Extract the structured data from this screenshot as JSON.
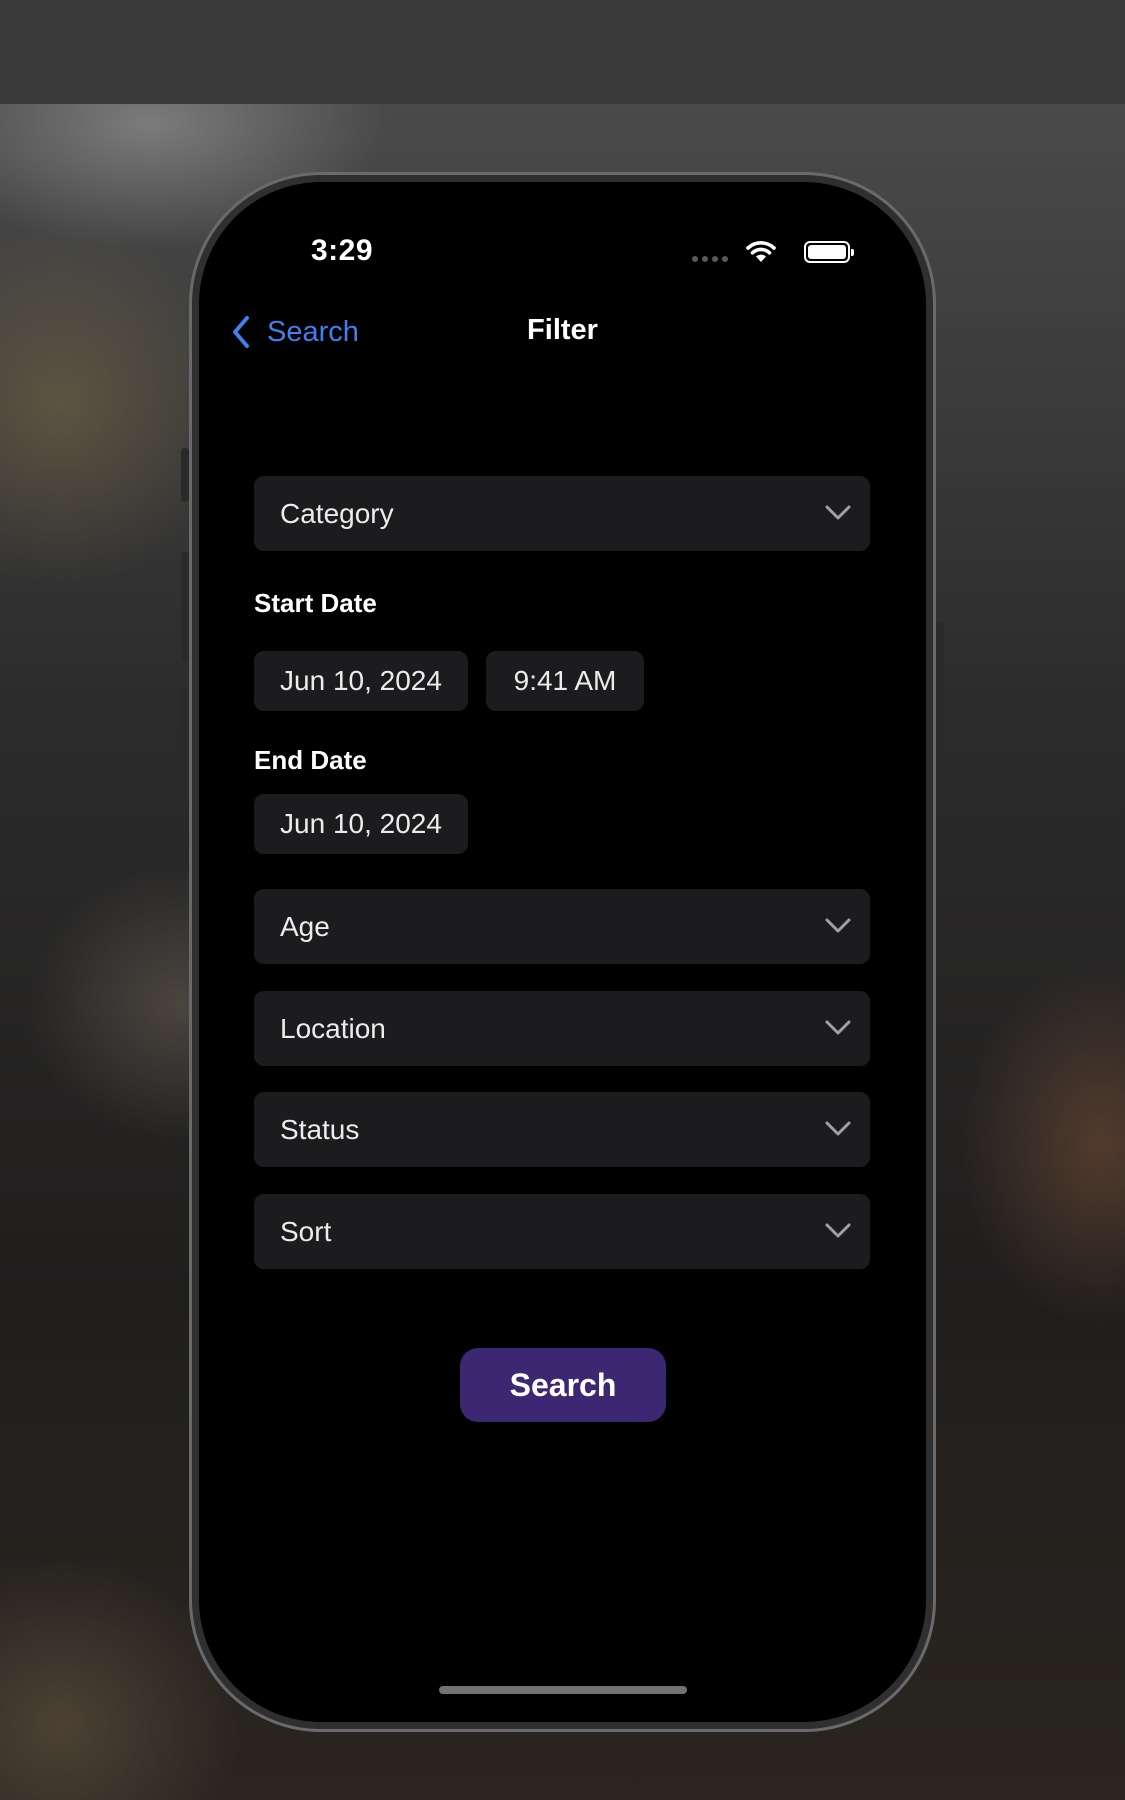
{
  "status_bar": {
    "time": "3:29",
    "icons": [
      "signal-dots-icon",
      "wifi-icon",
      "battery-icon"
    ]
  },
  "nav": {
    "back_label": "Search",
    "title": "Filter"
  },
  "filters": {
    "category": "Category",
    "start_date_label": "Start Date",
    "start_date": "Jun 10, 2024",
    "start_time": "9:41 AM",
    "end_date_label": "End Date",
    "end_date": "Jun 10, 2024",
    "age": "Age",
    "location": "Location",
    "status": "Status",
    "sort": "Sort"
  },
  "actions": {
    "search_label": "Search"
  },
  "colors": {
    "accent_link": "#3f7ff0",
    "button": "#3b2772",
    "field_bg": "#1c1c1e",
    "screen_bg": "#000000"
  }
}
